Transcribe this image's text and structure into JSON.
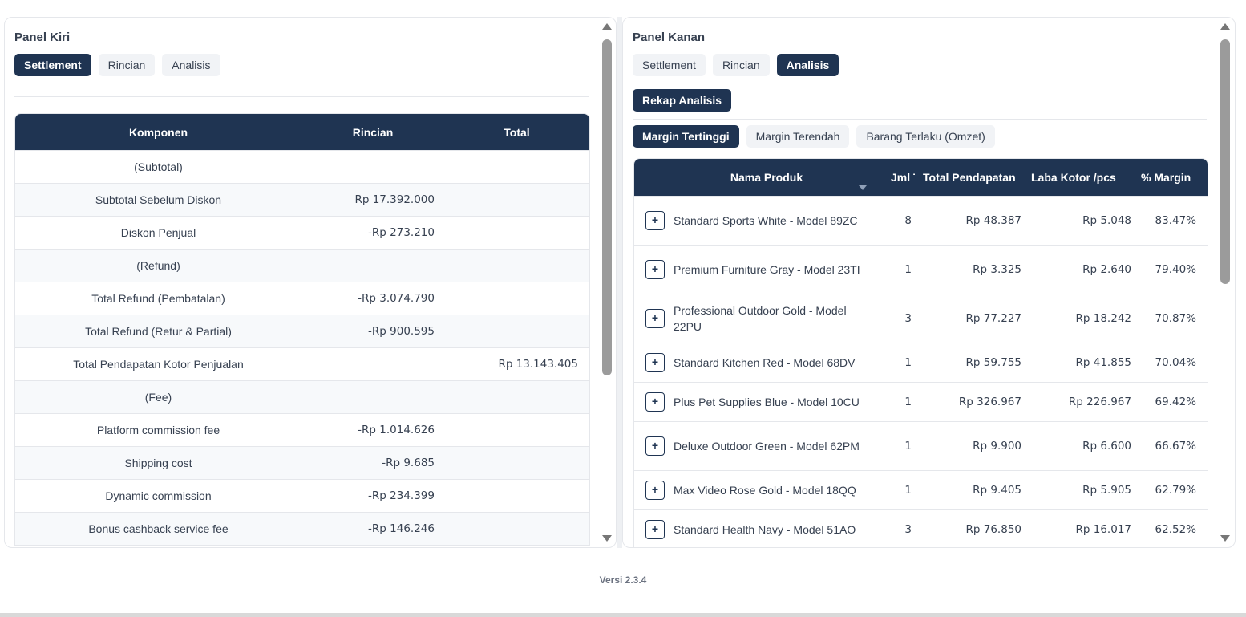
{
  "left_panel": {
    "title": "Panel Kiri",
    "tabs": [
      {
        "label": "Settlement",
        "active": true
      },
      {
        "label": "Rincian",
        "active": false
      },
      {
        "label": "Analisis",
        "active": false
      }
    ],
    "table": {
      "headers": [
        "Komponen",
        "Rincian",
        "Total"
      ],
      "rows": [
        {
          "komponen": "(Subtotal)",
          "rincian": "",
          "total": ""
        },
        {
          "komponen": "Subtotal Sebelum Diskon",
          "rincian": "Rp 17.392.000",
          "total": ""
        },
        {
          "komponen": "Diskon Penjual",
          "rincian": "-Rp 273.210",
          "total": ""
        },
        {
          "komponen": "(Refund)",
          "rincian": "",
          "total": ""
        },
        {
          "komponen": "Total Refund (Pembatalan)",
          "rincian": "-Rp 3.074.790",
          "total": ""
        },
        {
          "komponen": "Total Refund (Retur & Partial)",
          "rincian": "-Rp 900.595",
          "total": ""
        },
        {
          "komponen": "Total Pendapatan Kotor Penjualan",
          "rincian": "",
          "total": "Rp 13.143.405"
        },
        {
          "komponen": "(Fee)",
          "rincian": "",
          "total": ""
        },
        {
          "komponen": "Platform commission fee",
          "rincian": "-Rp 1.014.626",
          "total": ""
        },
        {
          "komponen": "Shipping cost",
          "rincian": "-Rp 9.685",
          "total": ""
        },
        {
          "komponen": "Dynamic commission",
          "rincian": "-Rp 234.399",
          "total": ""
        },
        {
          "komponen": "Bonus cashback service fee",
          "rincian": "-Rp 146.246",
          "total": ""
        }
      ]
    }
  },
  "right_panel": {
    "title": "Panel Kanan",
    "tabs": [
      {
        "label": "Settlement",
        "active": false
      },
      {
        "label": "Rincian",
        "active": false
      },
      {
        "label": "Analisis",
        "active": true
      }
    ],
    "rekap_button": "Rekap Analisis",
    "subtabs": [
      {
        "label": "Margin Tertinggi",
        "active": true
      },
      {
        "label": "Margin Terendah",
        "active": false
      },
      {
        "label": "Barang Terlaku (Omzet)",
        "active": false
      }
    ],
    "table": {
      "headers": [
        "Nama Produk",
        "Jml Te",
        "Total Pendapatan",
        "Laba Kotor /pcs",
        "% Margin"
      ],
      "expand_symbol": "+",
      "rows": [
        {
          "name": "Standard Sports White - Model 89ZC",
          "qty": "8",
          "revenue": "Rp 48.387",
          "profit": "Rp 5.048",
          "margin": "83.47%"
        },
        {
          "name": "Premium Furniture Gray - Model 23TI",
          "qty": "1",
          "revenue": "Rp 3.325",
          "profit": "Rp 2.640",
          "margin": "79.40%"
        },
        {
          "name": "Professional Outdoor Gold - Model 22PU",
          "qty": "3",
          "revenue": "Rp 77.227",
          "profit": "Rp 18.242",
          "margin": "70.87%"
        },
        {
          "name": "Standard Kitchen Red - Model 68DV",
          "qty": "1",
          "revenue": "Rp 59.755",
          "profit": "Rp 41.855",
          "margin": "70.04%"
        },
        {
          "name": "Plus Pet Supplies Blue - Model 10CU",
          "qty": "1",
          "revenue": "Rp 326.967",
          "profit": "Rp 226.967",
          "margin": "69.42%"
        },
        {
          "name": "Deluxe Outdoor Green - Model 62PM",
          "qty": "1",
          "revenue": "Rp 9.900",
          "profit": "Rp 6.600",
          "margin": "66.67%"
        },
        {
          "name": "Max Video Rose Gold - Model 18QQ",
          "qty": "1",
          "revenue": "Rp 9.405",
          "profit": "Rp 5.905",
          "margin": "62.79%"
        },
        {
          "name": "Standard Health Navy - Model 51AO",
          "qty": "3",
          "revenue": "Rp 76.850",
          "profit": "Rp 16.017",
          "margin": "62.52%"
        }
      ]
    }
  },
  "footer": {
    "version": "Versi 2.3.4"
  },
  "colors": {
    "primary": "#1f3452",
    "tab_bg": "#f1f3f6",
    "row_alt": "#f7f9fb"
  }
}
